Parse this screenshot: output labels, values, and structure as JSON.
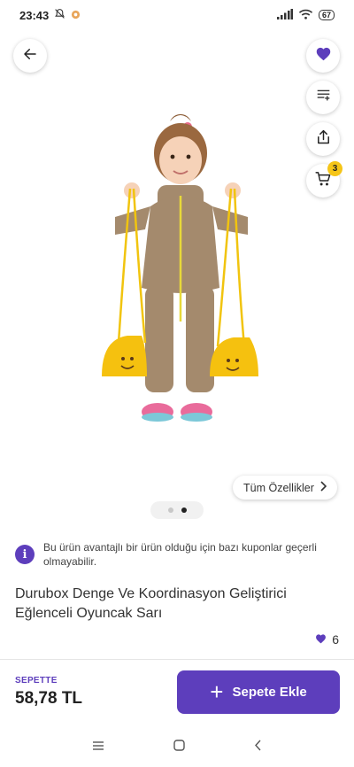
{
  "status_bar": {
    "time": "23:43",
    "battery": "67"
  },
  "icons": {
    "back": "arrow-left-icon",
    "favorite": "heart-icon",
    "filter": "list-filter-icon",
    "share": "share-icon",
    "cart": "cart-icon",
    "info": "info-icon",
    "chevron": "chevron-right-icon",
    "plus": "plus-icon"
  },
  "cart": {
    "badge_count": "3"
  },
  "gallery": {
    "features_label": "Tüm Özellikler",
    "pages": 2,
    "active_page": 1
  },
  "notice": {
    "icon_glyph": "i",
    "text": "Bu ürün avantajlı bir ürün olduğu için bazı kuponlar geçerli olmayabilir."
  },
  "product": {
    "title": "Durubox Denge Ve Koordinasyon Geliştirici Eğlenceli Oyuncak Sarı",
    "favorite_count": "6"
  },
  "footer": {
    "cart_label": "SEPETTE",
    "price": "58,78 TL",
    "add_label": "Sepete Ekle",
    "plus_glyph": "+"
  },
  "colors": {
    "brand": "#5d3ebc",
    "badge": "#f5c518"
  }
}
